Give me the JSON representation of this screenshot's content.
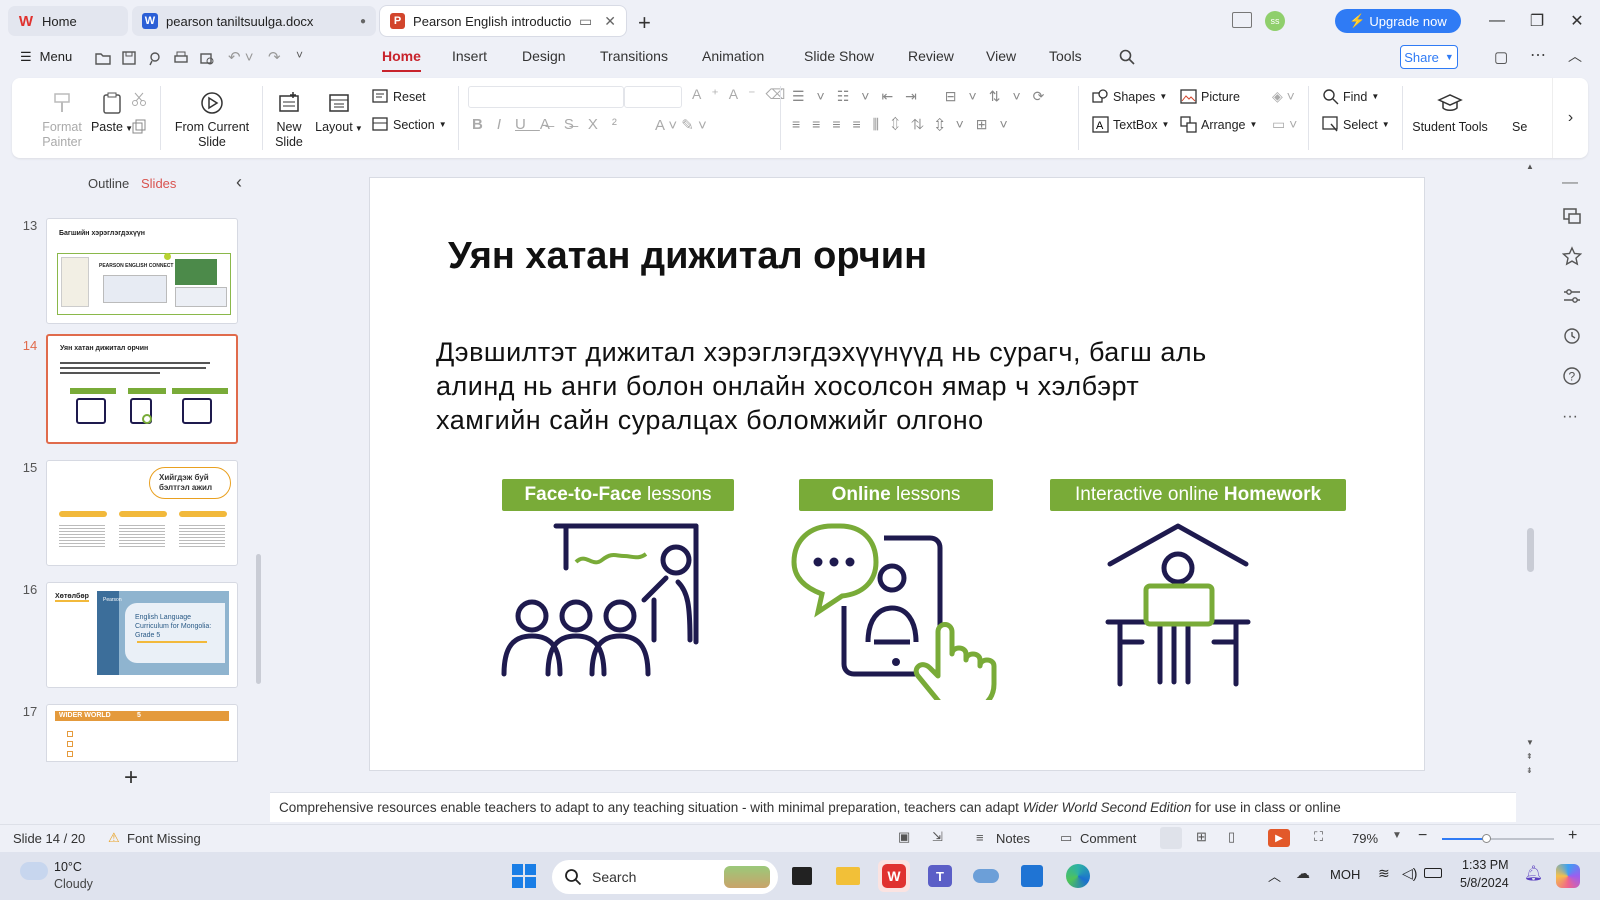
{
  "tabs": [
    {
      "label": "Home"
    },
    {
      "label": "pearson taniltsuulga.docx"
    },
    {
      "label": "Pearson English introduction.p"
    }
  ],
  "titlebar": {
    "upgrade_label": "Upgrade now",
    "avatar_initials": "ss",
    "new_tab": "+"
  },
  "menu": {
    "menu_label": "Menu",
    "tabs": [
      "Home",
      "Insert",
      "Design",
      "Transitions",
      "Animation",
      "Slide Show",
      "Review",
      "View",
      "Tools"
    ],
    "share_label": "Share"
  },
  "ribbon": {
    "format_painter": "Format Painter",
    "paste": "Paste",
    "from_current_slide": "From Current Slide",
    "new_slide": "New Slide",
    "layout": "Layout",
    "reset": "Reset",
    "section": "Section",
    "shapes": "Shapes",
    "picture": "Picture",
    "textbox": "TextBox",
    "arrange": "Arrange",
    "find": "Find",
    "select": "Select",
    "student_tools": "Student Tools",
    "more": "Se"
  },
  "panel": {
    "outline_label": "Outline",
    "slides_label": "Slides",
    "add_symbol": "+"
  },
  "thumbnails": [
    {
      "num": "13",
      "title": "Багшийн хэрэглэгдэхүүн",
      "caption": "PEARSON ENGLISH CONNECT"
    },
    {
      "num": "14",
      "title": "Уян хатан дижитал орчин",
      "selected": true,
      "badges": [
        "Face-to-Face lessons",
        "Online lessons",
        "Interactive online Homework"
      ]
    },
    {
      "num": "15",
      "title": "Хийгдэж буй бэлтгэл ажил"
    },
    {
      "num": "16",
      "title": "Хөтөлбөр",
      "caption": "English Language Curriculum for Mongolia: Grade 5",
      "brand": "Pearson"
    },
    {
      "num": "17",
      "title": "WIDER WORLD",
      "badge": "5"
    }
  ],
  "slide": {
    "title": "Уян хатан дижитал орчин",
    "body_lines": [
      "Дэвшилтэт дижитал хэрэглэгдэхүүнүүд нь сурагч, багш аль",
      "алинд нь анги болон онлайн хосолсон ямар ч хэлбэрт",
      "хамгийн сайн суралцах боломжийг олгоно"
    ],
    "badges": [
      {
        "bold": "Face-to-Face",
        "rest": " lessons"
      },
      {
        "bold": "Online",
        "rest": " lessons"
      },
      {
        "pre": "Interactive online ",
        "bold": "Homework"
      }
    ],
    "accent_green": "#79ab38",
    "icon_navy": "#1e1a4e"
  },
  "notes": {
    "text_before": "Comprehensive resources enable teachers to adapt to any teaching situation - with minimal preparation, teachers can adapt ",
    "text_italic": "Wider World Second Edition",
    "text_after": " for use in class or online"
  },
  "status": {
    "slide_info": "Slide 14 / 20",
    "font_missing": "Font Missing",
    "notes_label": "Notes",
    "comment_label": "Comment",
    "zoom": "79%"
  },
  "taskbar": {
    "weather_temp": "10°C",
    "weather_desc": "Cloudy",
    "search_placeholder": "Search",
    "language": "МОН",
    "time": "1:33 PM",
    "date": "5/8/2024"
  }
}
